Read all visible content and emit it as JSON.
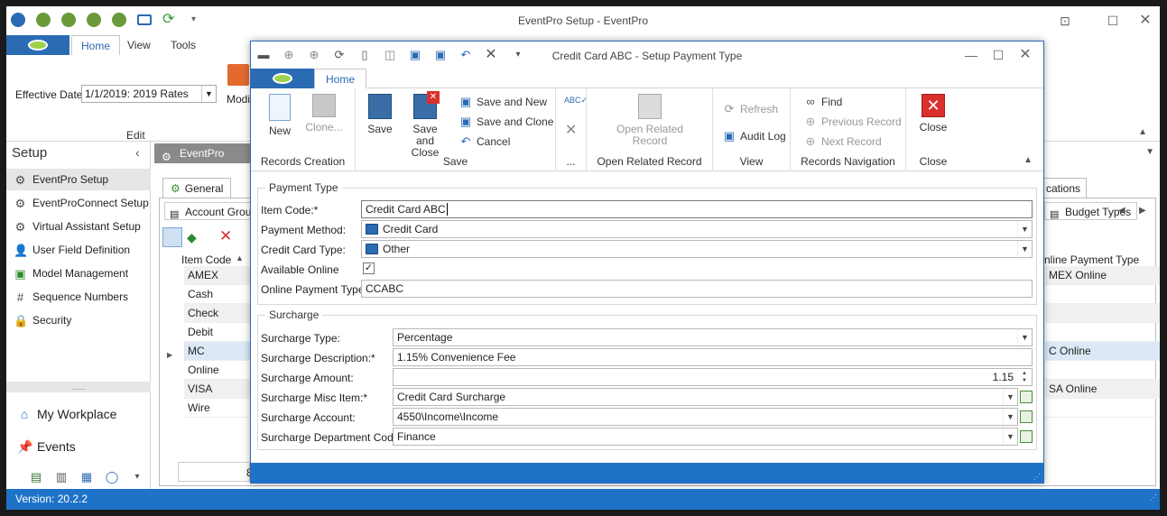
{
  "main_window": {
    "title": "EventPro Setup - EventPro",
    "tabs": [
      "Home",
      "View",
      "Tools"
    ],
    "effective_date_label": "Effective Date",
    "effective_date_value": "1/1/2019: 2019 Rates",
    "modify_label": "Modif",
    "edit_group_label": "Edit",
    "status_version": "Version: 20.2.2"
  },
  "sidebar": {
    "header": "Setup",
    "items": [
      {
        "label": "EventPro Setup",
        "icon": "gear-icon"
      },
      {
        "label": "EventProConnect Setup",
        "icon": "gear-icon"
      },
      {
        "label": "Virtual Assistant Setup",
        "icon": "gear-icon"
      },
      {
        "label": "User Field Definition",
        "icon": "user-icon"
      },
      {
        "label": "Model Management",
        "icon": "model-icon"
      },
      {
        "label": "Sequence Numbers",
        "icon": "hash-icon"
      },
      {
        "label": "Security",
        "icon": "lock-icon"
      }
    ],
    "splitter": "......",
    "big_items": [
      {
        "label": "My Workplace",
        "icon": "home-icon"
      },
      {
        "label": "Events",
        "icon": "pin-icon"
      }
    ]
  },
  "content": {
    "doc_tab": "EventPro Setup",
    "inner_tab_general": "General",
    "inner_tab_right": "cations",
    "sub_tab_account_group": "Account Group",
    "sub_tab_budget_types": "Budget Types",
    "grid_header_item_code": "Item Code",
    "grid_header_online_payment_type": "nline Payment Type",
    "grid_rows": [
      "AMEX",
      "Cash",
      "Check",
      "Debit",
      "MC",
      "Online",
      "VISA",
      "Wire"
    ],
    "grid_right_rows": [
      "MEX Online",
      "",
      "",
      "",
      "C Online",
      "",
      "SA Online",
      ""
    ],
    "footer_fragment": "8"
  },
  "dialog": {
    "title": "Credit Card ABC - Setup Payment Type",
    "tab_home": "Home",
    "ribbon": {
      "new": "New",
      "clone": "Clone...",
      "records_creation": "Records Creation",
      "save": "Save",
      "save_and_close": "Save and Close",
      "save_and_new": "Save and New",
      "save_and_clone": "Save and Clone",
      "cancel": "Cancel",
      "save_group": "Save",
      "more_group": "...",
      "open_related_record": "Open Related Record",
      "open_related_group": "Open Related Record",
      "refresh": "Refresh",
      "audit_log": "Audit Log",
      "view_group": "View",
      "find": "Find",
      "previous_record": "Previous Record",
      "next_record": "Next Record",
      "navigation_group": "Records Navigation",
      "close": "Close",
      "close_group": "Close"
    },
    "payment_type": {
      "legend": "Payment Type",
      "item_code_label": "Item Code:*",
      "item_code_value": "Credit Card ABC",
      "payment_method_label": "Payment Method:",
      "payment_method_value": "Credit Card",
      "credit_card_type_label": "Credit Card Type:",
      "credit_card_type_value": "Other",
      "available_online_label": "Available Online",
      "available_online_checked": true,
      "online_payment_type_label": "Online Payment Type:",
      "online_payment_type_value": "CCABC"
    },
    "surcharge": {
      "legend": "Surcharge",
      "type_label": "Surcharge Type:",
      "type_value": "Percentage",
      "description_label": "Surcharge Description:*",
      "description_value": "1.15% Convenience Fee",
      "amount_label": "Surcharge Amount:",
      "amount_value": "1.15",
      "misc_item_label": "Surcharge Misc Item:*",
      "misc_item_value": "Credit Card Surcharge",
      "account_label": "Surcharge Account:",
      "account_value": "4550\\Income\\Income",
      "department_label": "Surcharge Department Code:",
      "department_value": "Finance"
    }
  },
  "colors": {
    "accent_blue": "#1e73c8",
    "close_red": "#d9302c"
  }
}
